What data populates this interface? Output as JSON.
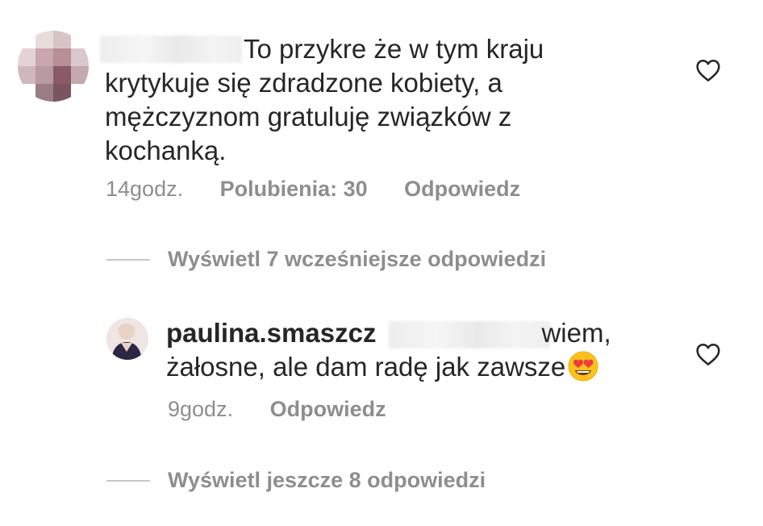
{
  "comment": {
    "text_line1": "To przykre że w tym kraju",
    "text_rest": "krytykuje się zdradzone kobiety, a mężczyznom gratuluję związków z kochanką.",
    "time": "14godz.",
    "likes": "Polubienia: 30",
    "reply_label": "Odpowiedz",
    "like_icon": "heart-outline-icon"
  },
  "view_earlier_replies": "Wyświetl 7 wcześniejsze odpowiedzi",
  "reply": {
    "username": "paulina.smaszcz",
    "text_after_redaction": "wiem,",
    "text_line2": "żałosne, ale dam radę jak zawsze",
    "emoji": "heart-eyes-emoji",
    "time": "9godz.",
    "reply_label": "Odpowiedz",
    "like_icon": "heart-outline-icon"
  },
  "view_more_replies": "Wyświetl jeszcze 8 odpowiedzi",
  "colors": {
    "text": "#262626",
    "secondary": "#8e8e8e",
    "divider": "#c7c7c7",
    "background": "#ffffff"
  }
}
